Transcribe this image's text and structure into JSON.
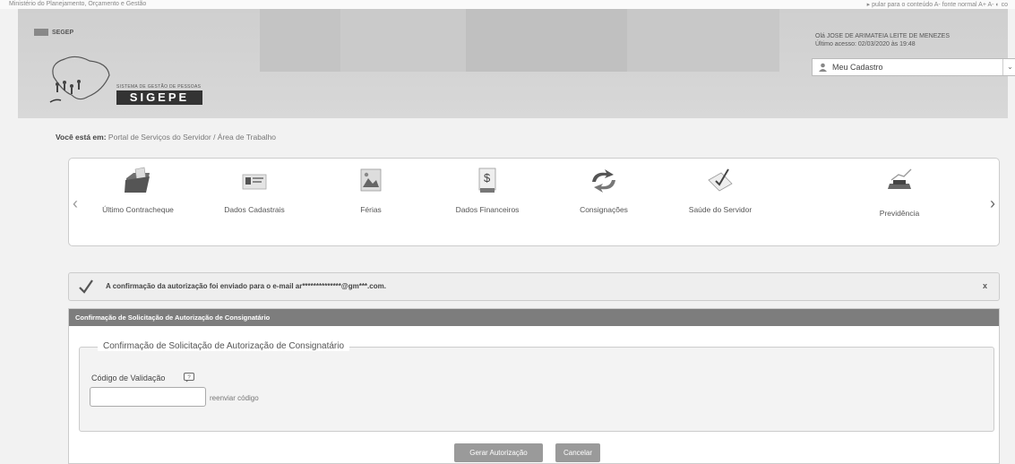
{
  "top_bar": {
    "left_text": "Ministério do Planejamento, Orçamento e Gestão",
    "right_text": "▸ pular para o conteúdo   A- fonte normal   A+   A-   ◐ co"
  },
  "header": {
    "segep_label": "SEGEP",
    "system_subtitle": "SISTEMA DE GESTÃO DE PESSOAS",
    "system_name": "SIGEPE",
    "user_greeting": "Olá JOSE DE ARIMATEIA LEITE DE MENEZES",
    "last_access": "Último acesso: 02/03/2020 às 19:48",
    "profile_select": "Meu Cadastro"
  },
  "breadcrumb": {
    "prefix": "Você está em:",
    "path": "Portal de Serviços do Servidor / Área de Trabalho"
  },
  "services": [
    {
      "label": "Último Contracheque",
      "icon": "folder-icon"
    },
    {
      "label": "Dados Cadastrais",
      "icon": "id-card-icon"
    },
    {
      "label": "Férias",
      "icon": "beach-photo-icon"
    },
    {
      "label": "Dados Financeiros",
      "icon": "money-document-icon"
    },
    {
      "label": "Consignações",
      "icon": "arrows-cycle-icon"
    },
    {
      "label": "Saúde do Servidor",
      "icon": "health-check-icon"
    },
    {
      "label": "Previdência",
      "icon": "chart-up-icon"
    }
  ],
  "alert": {
    "message": "A confirmação da autorização foi enviado para o e-mail ar**************@gm***.com.",
    "close": "x"
  },
  "panel": {
    "title": "Confirmação de Solicitação de Autorização de Consignatário",
    "legend": "Confirmação de Solicitação de Autorização de Consignatário",
    "code_label": "Código de Validação",
    "code_value": "",
    "resend_link": "reenviar código"
  },
  "buttons": {
    "generate": "Gerar Autorização",
    "cancel": "Cancelar"
  },
  "colors": {
    "panel_header": "#7d7d7d",
    "button": "#9a9a9a",
    "header_bg": "#d0d0d0"
  }
}
